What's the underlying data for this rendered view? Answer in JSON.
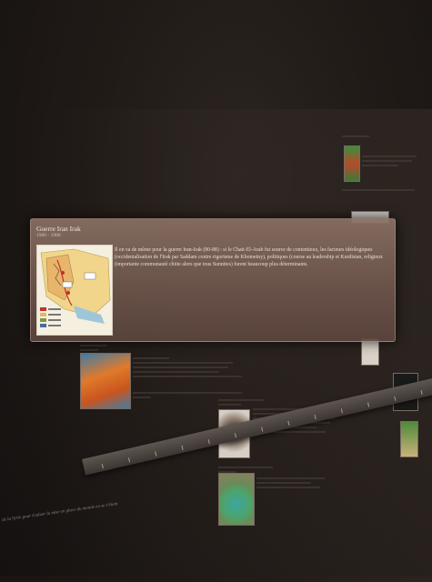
{
  "popup": {
    "title": "Guerre Iran Irak",
    "dates": "1980 - 1988",
    "body": "Il en va de même pour la guerre Iran-Irak (80-88) : si le Chatt-El-Arab fut source de contentieux, les facteurs idéologiques (occidentalisation de l'Irak par Saddam contre rigorisme de Khomeiny), politiques (course au leadership et Kurdistan, religieux (importante communauté chiite alors que tous Sunnites) furent beaucoup plus déterminants.",
    "map_icon": "iran-iraq-war-map"
  },
  "background": {
    "caption_left": "de la Syrie pour évaluer la mise en place du monde en se s'étant",
    "colors": {
      "popup": "#7c6054",
      "background": "#1b1613",
      "timeline": "#4e4641"
    }
  }
}
